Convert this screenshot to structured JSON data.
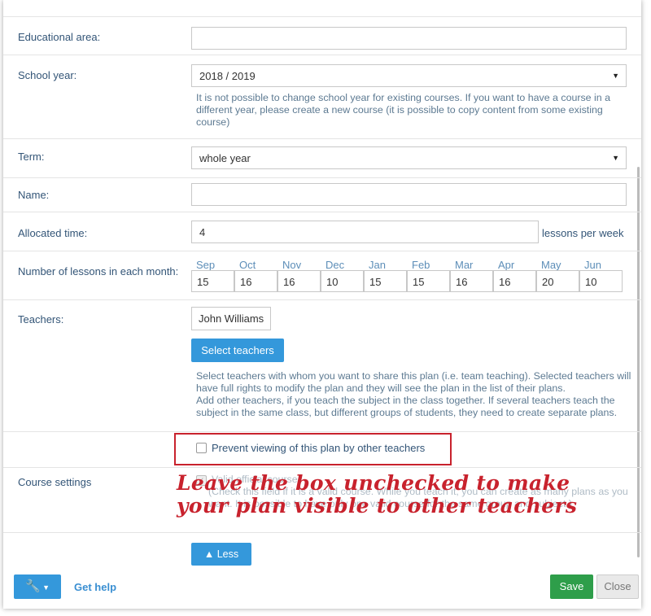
{
  "fields": {
    "educational_area": {
      "label": "Educational area:",
      "value": ""
    },
    "school_year": {
      "label": "School year:",
      "value": "2018 / 2019",
      "hint": "It is not possible to change school year for existing courses. If you want to have a course in a different year, please create a new course (it is possible to copy content from some existing course)"
    },
    "term": {
      "label": "Term:",
      "value": "whole year"
    },
    "name": {
      "label": "Name:",
      "value": ""
    },
    "allocated_time": {
      "label": "Allocated time:",
      "value": "4",
      "unit": "lessons per week"
    },
    "lessons_per_month": {
      "label": "Number of lessons in each month:",
      "months": [
        {
          "name": "Sep",
          "value": "15"
        },
        {
          "name": "Oct",
          "value": "16"
        },
        {
          "name": "Nov",
          "value": "16"
        },
        {
          "name": "Dec",
          "value": "10"
        },
        {
          "name": "Jan",
          "value": "15"
        },
        {
          "name": "Feb",
          "value": "15"
        },
        {
          "name": "Mar",
          "value": "16"
        },
        {
          "name": "Apr",
          "value": "16"
        },
        {
          "name": "May",
          "value": "20"
        },
        {
          "name": "Jun",
          "value": "10"
        }
      ]
    },
    "teachers": {
      "label": "Teachers:",
      "selected": "John Williams",
      "button": "Select teachers",
      "hint_1": "Select teachers with whom you want to share this plan (i.e. team teaching). Selected teachers will have full rights to modify the plan and they will see the plan in the list of their plans.",
      "hint_2": "Add other teachers, if you teach the subject in the class together. If several teachers teach the subject in the same class, but different groups of students, they need to create separate plans."
    },
    "prevent_viewing": {
      "label": "Prevent viewing of this plan by other teachers",
      "checked": false
    },
    "course_settings": {
      "label": "Course settings",
      "valid_label": "Valid official course",
      "checked": true,
      "hint": "(Check this field if it is a valid course. While you teach it, you can create as many plans as you want. It is possible to have only one valid course for the same group and subject.)"
    }
  },
  "annotation": {
    "line_1": "Leave the box unchecked to make",
    "line_2": "your plan visible to other teachers"
  },
  "buttons": {
    "less": "▲ Less",
    "tools_icon": "wrench-icon",
    "get_help": "Get help",
    "save": "Save",
    "close": "Close"
  },
  "colors": {
    "primary": "#3498db",
    "save": "#2e9e4a",
    "annotation": "#c8222d",
    "label": "#335577"
  }
}
